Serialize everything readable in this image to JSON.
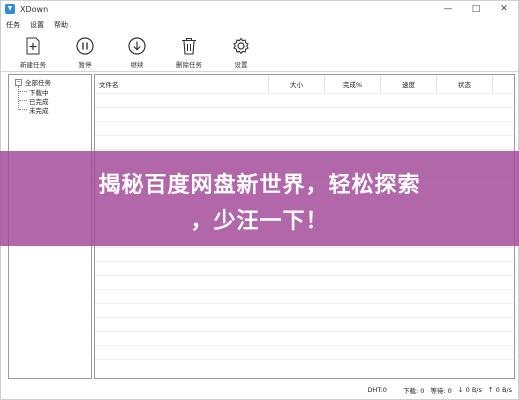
{
  "window": {
    "title": "XDown"
  },
  "menu": [
    "任务",
    "设置",
    "帮助"
  ],
  "toolbar": [
    {
      "label": "新建任务",
      "icon": "new-task-icon"
    },
    {
      "label": "暂停",
      "icon": "pause-icon"
    },
    {
      "label": "继续",
      "icon": "resume-icon"
    },
    {
      "label": "删除任务",
      "icon": "delete-icon"
    },
    {
      "label": "设置",
      "icon": "gear-icon"
    }
  ],
  "tree": {
    "root": "全部任务",
    "children": [
      "下载中",
      "已完成",
      "未完成"
    ]
  },
  "list": {
    "columns": [
      "文件名",
      "大小",
      "完成%",
      "速度",
      "状态"
    ],
    "rows": []
  },
  "status": {
    "dht": "DHT:0",
    "download": "下载: 0",
    "waiting": "等待: 0",
    "down_speed": "0 B/s",
    "up_speed": "0 B/s"
  },
  "overlay": {
    "line1": "揭秘百度网盘新世界，轻松探索",
    "line2": "，少汪一下！",
    "color": "#a0469a"
  }
}
